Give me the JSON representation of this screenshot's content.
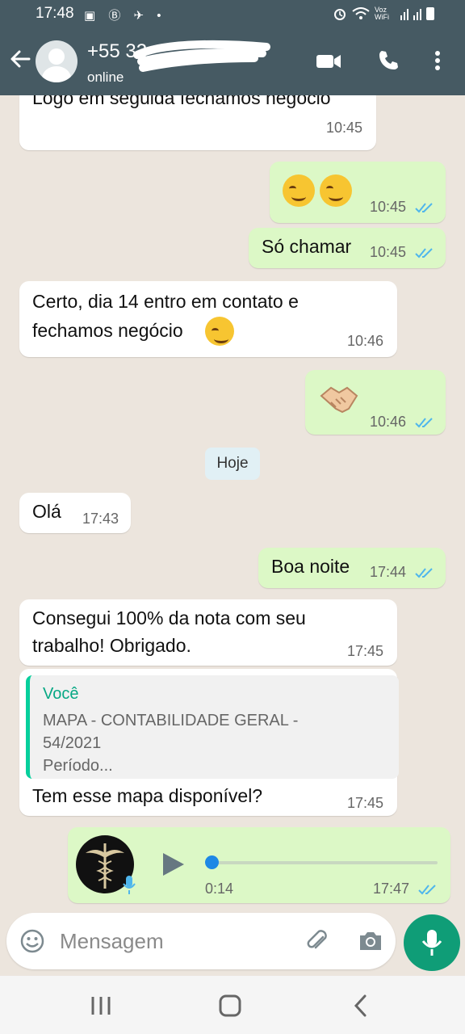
{
  "status_bar": {
    "time": "17:48",
    "left_icons": "▣ Ⓑ ✈ •",
    "right_text": "Voz WiFi"
  },
  "header": {
    "contact_name": "+55 32",
    "contact_status": "online",
    "icons": [
      "back-arrow-icon",
      "avatar",
      "video-call-icon",
      "phone-icon",
      "more-icon"
    ],
    "color": "#465a63"
  },
  "messages": [
    {
      "direction": "in",
      "text": "Logo em seguida fechamos negócio",
      "time": "10:45"
    },
    {
      "direction": "out",
      "text": "",
      "emojis": [
        "smirk",
        "smirk"
      ],
      "time": "10:45",
      "read": true
    },
    {
      "direction": "out",
      "text": "Só chamar",
      "time": "10:45",
      "read": true
    },
    {
      "direction": "in",
      "line1": "Certo, dia 14 entro em contato e",
      "line2": "fechamos negócio",
      "emojis": [
        "smirk"
      ],
      "time": "10:46"
    },
    {
      "direction": "out",
      "text": "",
      "emojis": [
        "handshake"
      ],
      "time": "10:46",
      "read": true
    },
    {
      "direction": "in",
      "text": "Olá",
      "time": "17:43"
    },
    {
      "direction": "out",
      "text": "Boa noite",
      "time": "17:44",
      "read": true
    },
    {
      "direction": "in",
      "line1": "Consegui 100% da nota com seu",
      "line2": "trabalho! Obrigado.",
      "time": "17:45"
    },
    {
      "direction": "in",
      "quote_author": "Você",
      "quote_line1": "MAPA - CONTABILIDADE GERAL -",
      "quote_line2": "54/2021",
      "quote_line3": "Período...",
      "text": "Tem esse mapa disponível?",
      "time": "17:45"
    },
    {
      "direction": "out",
      "type": "voice",
      "duration": "0:14",
      "progress": 0.0,
      "time": "17:47",
      "read": true
    }
  ],
  "date_separator": "Hoje",
  "composer": {
    "placeholder": "Mensagem",
    "icons": [
      "emoji-icon",
      "attach-icon",
      "camera-icon",
      "mic-icon"
    ]
  },
  "nav": {
    "icons": [
      "recents-icon",
      "home-icon",
      "back-icon"
    ]
  },
  "colors": {
    "incoming": "#ffffff",
    "outgoing": "#dcf8c6",
    "read_ticks": "#4fb6ec",
    "accent": "#0f9d77",
    "wallpaper": "#ece5dd"
  }
}
